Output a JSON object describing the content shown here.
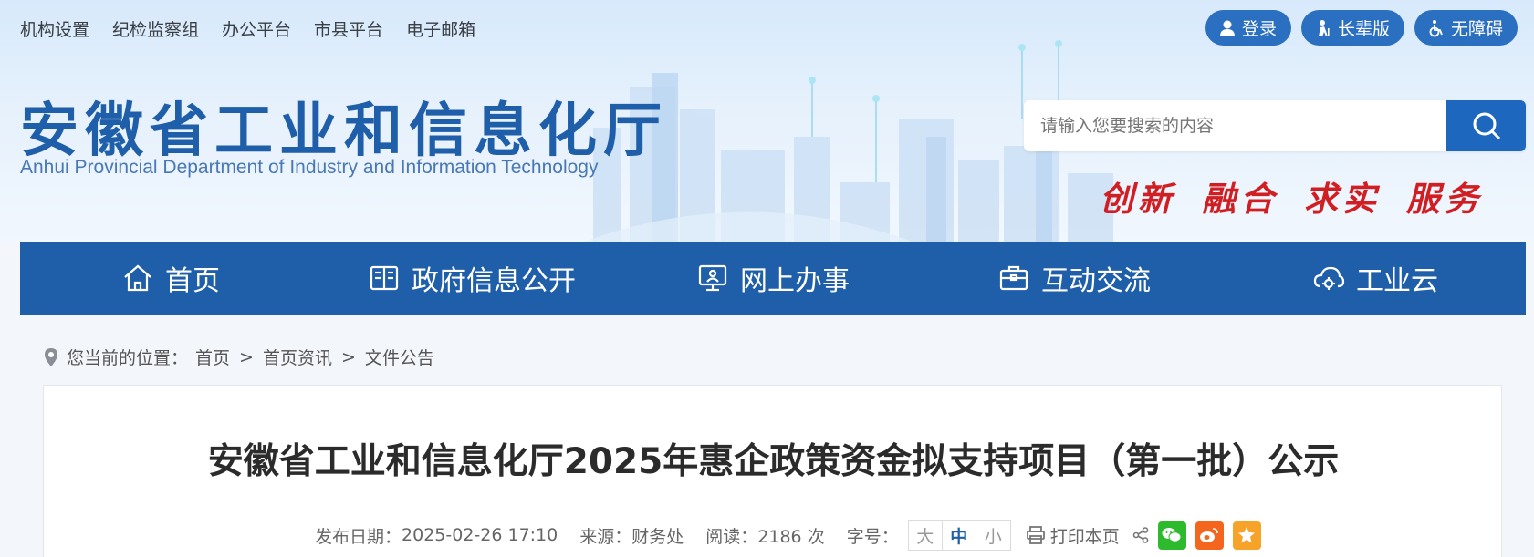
{
  "top_links": [
    "机构设置",
    "纪检监察组",
    "办公平台",
    "市县平台",
    "电子邮箱"
  ],
  "pills": {
    "login": "登录",
    "elderly": "长辈版",
    "accessible": "无障碍"
  },
  "site": {
    "title": "安徽省工业和信息化厅",
    "subtitle": "Anhui Provincial Department of Industry and Information Technology"
  },
  "search": {
    "placeholder": "请输入您要搜索的内容"
  },
  "slogan": [
    "创新",
    "融合",
    "求实",
    "服务"
  ],
  "nav": [
    "首页",
    "政府信息公开",
    "网上办事",
    "互动交流",
    "工业云"
  ],
  "breadcrumb": {
    "label": "您当前的位置：",
    "items": [
      "首页",
      "首页资讯",
      "文件公告"
    ],
    "separator": ">"
  },
  "article": {
    "title": "安徽省工业和信息化厅2025年惠企政策资金拟支持项目（第一批）公示",
    "date_label": "发布日期：",
    "date": "2025-02-26 17:10",
    "source_label": "来源：",
    "source": "财务处",
    "reads_label": "阅读：",
    "reads": "2186 次",
    "fontsize_label": "字号：",
    "fontsize_options": [
      "大",
      "中",
      "小"
    ],
    "print_label": "打印本页"
  },
  "colors": {
    "primary_blue": "#1f5ea9",
    "slogan_red": "#d01e22",
    "wechat_green": "#2dba2d",
    "weibo_orange": "#f4651e",
    "favorite_orange": "#f7a32a"
  }
}
